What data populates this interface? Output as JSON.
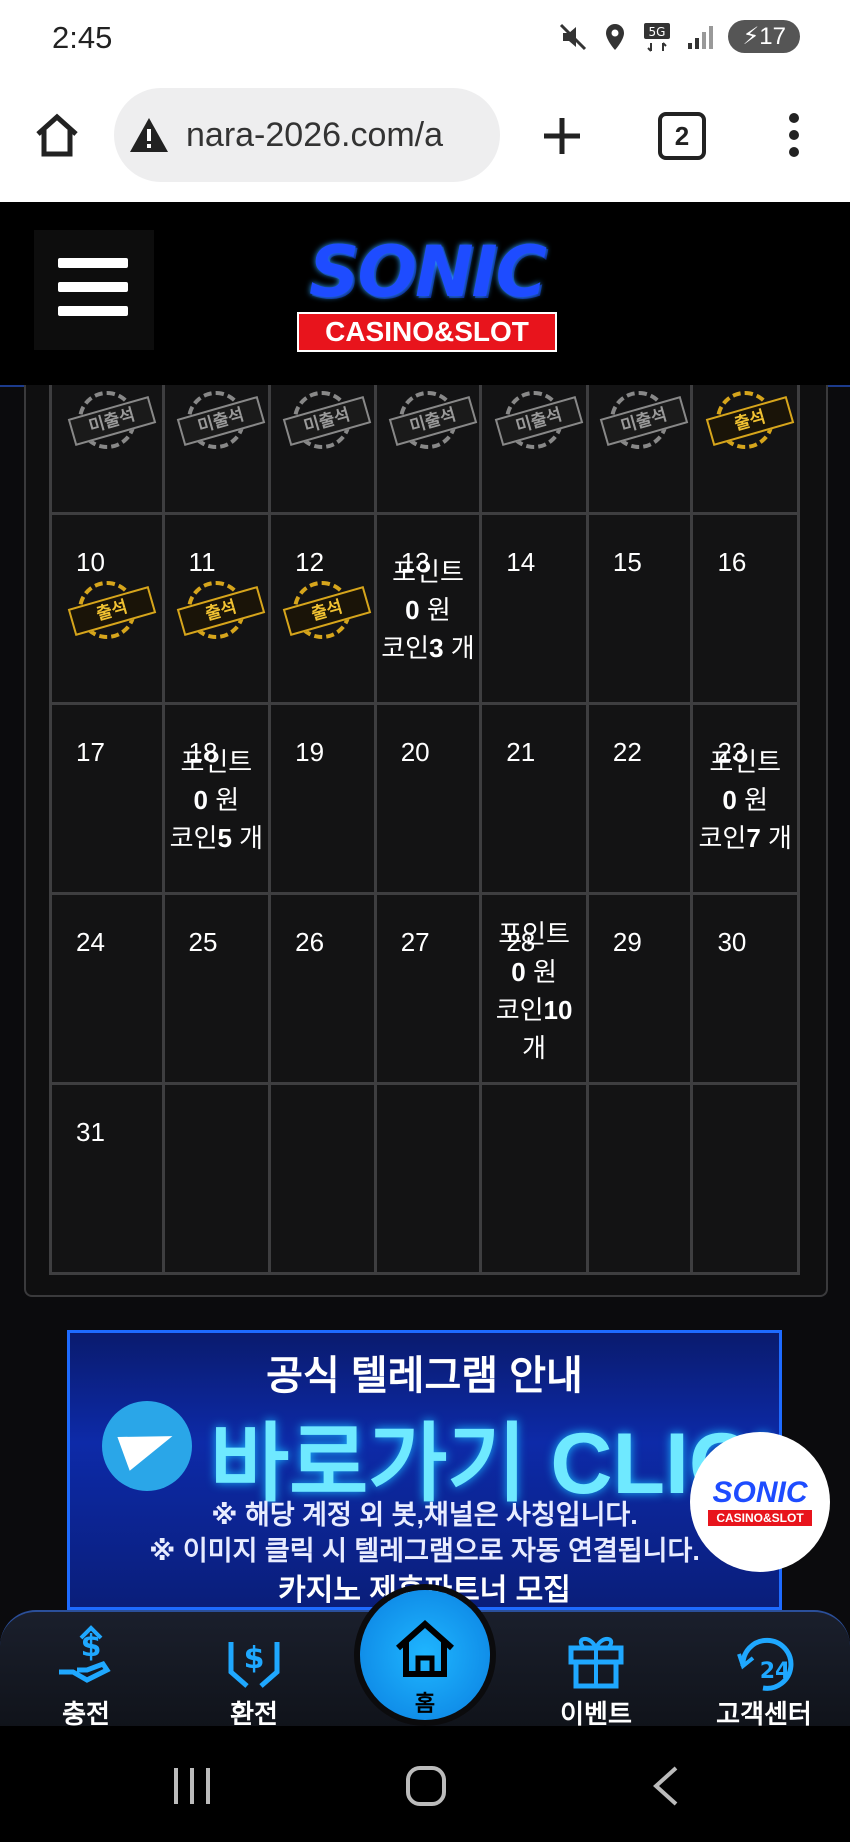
{
  "status_bar": {
    "time": "2:45",
    "battery": "17"
  },
  "browser": {
    "url": "nara-2026.com/a",
    "tab_count": "2"
  },
  "brand": {
    "logo_main": "SONIC",
    "logo_sub": "CASINO&SLOT"
  },
  "calendar": {
    "attendance_labels": {
      "absent": "미출석",
      "present": "출석"
    },
    "weeks": [
      {
        "days": [
          {
            "num": "",
            "stamp": "absent"
          },
          {
            "num": "",
            "stamp": "absent"
          },
          {
            "num": "",
            "stamp": "absent"
          },
          {
            "num": "",
            "stamp": "absent"
          },
          {
            "num": "",
            "stamp": "absent"
          },
          {
            "num": "",
            "stamp": "absent"
          },
          {
            "num": "",
            "stamp": "present"
          }
        ]
      },
      {
        "days": [
          {
            "num": "10",
            "stamp": "present"
          },
          {
            "num": "11",
            "stamp": "present"
          },
          {
            "num": "12",
            "stamp": "present"
          },
          {
            "num": "13",
            "reward": {
              "line1": "포인트",
              "points": "0",
              "won": "원",
              "coin_label": "코인",
              "coins": "3",
              "unit": "개"
            }
          },
          {
            "num": "14"
          },
          {
            "num": "15"
          },
          {
            "num": "16"
          }
        ]
      },
      {
        "days": [
          {
            "num": "17"
          },
          {
            "num": "18",
            "reward": {
              "line1": "포인트",
              "points": "0",
              "won": "원",
              "coin_label": "코인",
              "coins": "5",
              "unit": "개"
            }
          },
          {
            "num": "19"
          },
          {
            "num": "20"
          },
          {
            "num": "21"
          },
          {
            "num": "22"
          },
          {
            "num": "23",
            "reward": {
              "line1": "포인트",
              "points": "0",
              "won": "원",
              "coin_label": "코인",
              "coins": "7",
              "unit": "개"
            }
          }
        ]
      },
      {
        "days": [
          {
            "num": "24"
          },
          {
            "num": "25"
          },
          {
            "num": "26"
          },
          {
            "num": "27"
          },
          {
            "num": "28",
            "reward": {
              "line1": "포인트",
              "points": "0",
              "won": "원",
              "coin_label": "코인",
              "coins": "10",
              "unit": "개"
            }
          },
          {
            "num": "29"
          },
          {
            "num": "30"
          }
        ]
      },
      {
        "days": [
          {
            "num": "31"
          },
          {
            "num": ""
          },
          {
            "num": ""
          },
          {
            "num": ""
          },
          {
            "num": ""
          },
          {
            "num": ""
          },
          {
            "num": ""
          }
        ]
      }
    ]
  },
  "banner": {
    "title": "공식 텔레그램 안내",
    "click_text": "바로가기 CLICK",
    "note1": "※ 해당 계정 외 봇,채널은 사칭입니다.",
    "note2": "※ 이미지 클릭 시 텔레그램으로 자동 연결됩니다.",
    "partner": "카지노 제휴파트너 모집"
  },
  "bottom_nav": {
    "deposit": "충전",
    "withdraw": "환전",
    "home": "홈",
    "event": "이벤트",
    "support": "고객센터"
  },
  "colors": {
    "accent_blue": "#1fb6ff",
    "stamp_gold": "#d6a51c",
    "stamp_gray": "#888888"
  }
}
